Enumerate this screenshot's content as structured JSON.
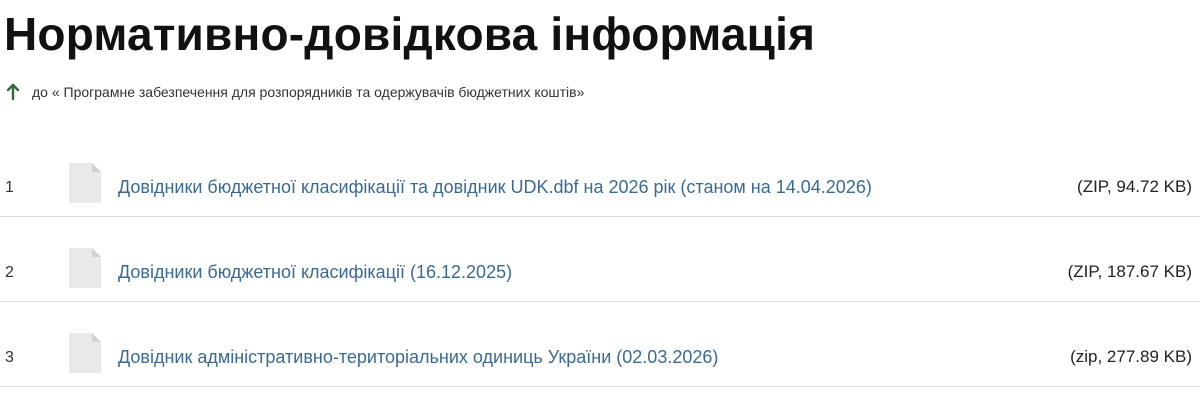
{
  "page": {
    "title": "Нормативно-довідкова інформація"
  },
  "back_link": {
    "icon": "arrow-up-icon",
    "icon_color": "#2e6b3a",
    "label": "до « Програмне забезпечення для розпорядників та одержувачів бюджетних коштів»"
  },
  "files": [
    {
      "number": "1",
      "icon": "document-icon",
      "title": "Довідники бюджетної класифікації та довідник UDK.dbf на 2026 рік (станом на 14.04.2026)",
      "size": "(ZIP, 94.72 KB)"
    },
    {
      "number": "2",
      "icon": "document-icon",
      "title": "Довідники бюджетної класифікації (16.12.2025)",
      "size": "(ZIP, 187.67 KB)"
    },
    {
      "number": "3",
      "icon": "document-icon",
      "title": "Довідник адміністративно-територіальних одиниць України (02.03.2026)",
      "size": "(zip, 277.89 KB)"
    }
  ],
  "colors": {
    "link": "#3a6a94",
    "divider": "#dedede",
    "file_icon": "#e6e6e6"
  }
}
